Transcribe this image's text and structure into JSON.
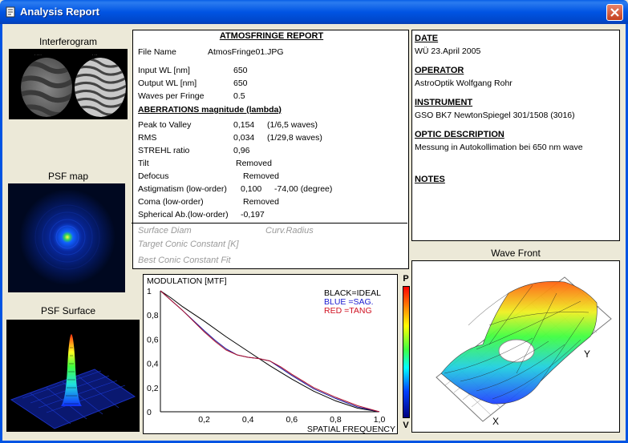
{
  "window": {
    "title": "Analysis  Report",
    "icon": "report-window-icon",
    "close_icon": "close-icon"
  },
  "panels": {
    "interferogram": "Interferogram",
    "psf_map": "PSF map",
    "psf_surface": "PSF Surface",
    "wave_front": "Wave Front",
    "interferogram_caption_left": "",
    "interferogram_caption_right": ""
  },
  "report": {
    "title": "ATMOSFRINGE REPORT",
    "file_name_label": "File Name",
    "file_name": "AtmosFringe01.JPG",
    "input_wl_label": "Input  WL [nm]",
    "input_wl": "650",
    "output_wl_label": "Output WL [nm]",
    "output_wl": "650",
    "waves_per_fringe_label": "Waves per Fringe",
    "waves_per_fringe": "0.5",
    "aberrations_head": "ABERRATIONS magnitude (lambda)",
    "ptv_label": "Peak to Valley",
    "ptv": "0,154",
    "ptv_waves": "(1/6,5 waves)",
    "rms_label": "RMS",
    "rms": "0,034",
    "rms_waves": "(1/29,8 waves)",
    "strehl_label": "STREHL ratio",
    "strehl": "0,96",
    "tilt_label": "Tilt",
    "tilt": "Removed",
    "defocus_label": "Defocus",
    "defocus": "Removed",
    "astig_label": "Astigmatism  (low-order)",
    "astig": "0,100",
    "astig_angle": "-74,00  (degree)",
    "coma_label": "Coma         (low-order)",
    "coma": "Removed",
    "spherical_label": "Spherical Ab.(low-order)",
    "spherical": "-0,197",
    "surface_diam": "Surface Diam",
    "curv_radius": "Curv.Radius",
    "target_conic": "Target Conic Constant [K]",
    "best_conic": "Best Conic Constant Fit"
  },
  "info": {
    "date_head": "DATE",
    "date": "WÜ 23.April 2005",
    "operator_head": "OPERATOR",
    "operator": "AstroOptik Wolfgang Rohr",
    "instrument_head": "INSTRUMENT",
    "instrument": "GSO BK7 NewtonSpiegel 301/1508 (3016)",
    "optic_head": "OPTIC DESCRIPTION",
    "optic": "Messung in Autokollimation bei 650 nm wave",
    "notes_head": "NOTES"
  },
  "wave_front": {
    "x_label": "X",
    "y_label": "Y"
  },
  "colorbar": {
    "top": "P",
    "bottom": "V"
  },
  "chart_data": {
    "type": "line",
    "title": "MODULATION    [MTF]",
    "xlabel": "SPATIAL FREQUENCY",
    "ylabel": "",
    "xlim": [
      0,
      1.0
    ],
    "ylim": [
      0,
      1.0
    ],
    "x_ticks": [
      "0,2",
      "0,4",
      "0,6",
      "0,8",
      "1,0"
    ],
    "y_ticks": [
      "0",
      "0,2",
      "0,4",
      "0,6",
      "0,8",
      "1"
    ],
    "legend": [
      "BLACK=IDEAL",
      "BLUE  =SAG.",
      "RED    =TANG"
    ],
    "legend_position": "top-right",
    "colors": {
      "ideal": "#000000",
      "sag": "#1a1aa0",
      "tang": "#b0102a"
    },
    "series": [
      {
        "name": "IDEAL",
        "x": [
          0,
          0.05,
          0.1,
          0.2,
          0.3,
          0.4,
          0.5,
          0.6,
          0.7,
          0.8,
          0.9,
          1.0
        ],
        "values": [
          1.0,
          0.94,
          0.87,
          0.75,
          0.62,
          0.5,
          0.38,
          0.27,
          0.17,
          0.09,
          0.03,
          0.0
        ]
      },
      {
        "name": "SAG.",
        "x": [
          0,
          0.05,
          0.1,
          0.2,
          0.25,
          0.3,
          0.35,
          0.4,
          0.45,
          0.5,
          0.55,
          0.6,
          0.7,
          0.8,
          0.9,
          1.0
        ],
        "values": [
          1.0,
          0.92,
          0.84,
          0.67,
          0.59,
          0.52,
          0.47,
          0.45,
          0.44,
          0.42,
          0.36,
          0.3,
          0.19,
          0.11,
          0.04,
          0.0
        ]
      },
      {
        "name": "TANG",
        "x": [
          0,
          0.05,
          0.1,
          0.2,
          0.25,
          0.3,
          0.35,
          0.4,
          0.45,
          0.5,
          0.55,
          0.6,
          0.7,
          0.8,
          0.9,
          1.0
        ],
        "values": [
          1.0,
          0.92,
          0.84,
          0.66,
          0.58,
          0.51,
          0.47,
          0.45,
          0.44,
          0.42,
          0.37,
          0.31,
          0.2,
          0.12,
          0.05,
          0.0
        ]
      }
    ]
  }
}
